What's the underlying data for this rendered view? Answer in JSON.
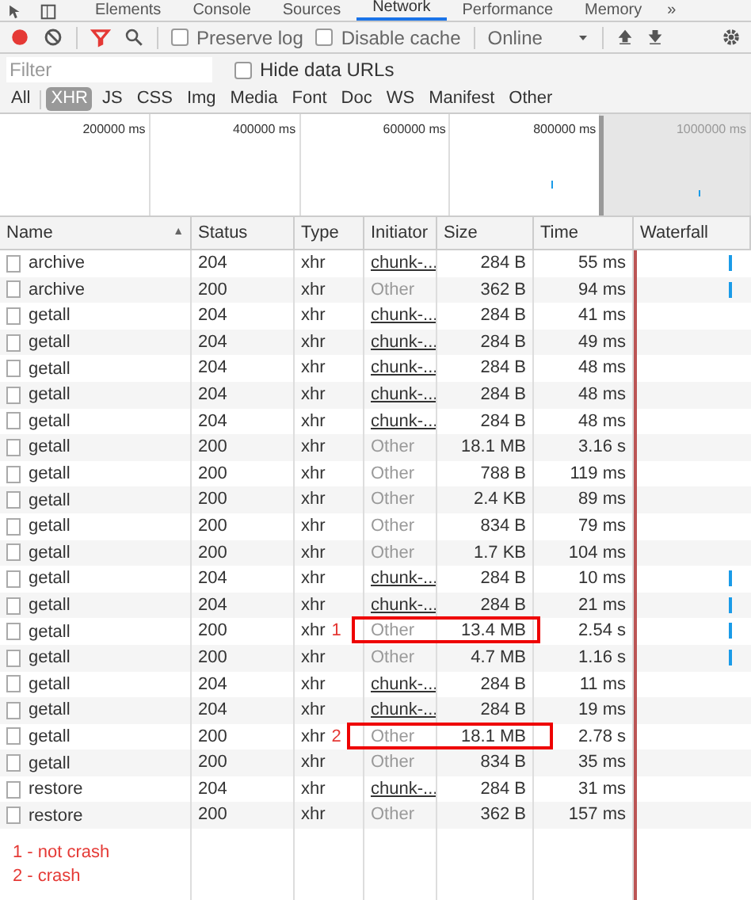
{
  "panel_tabs": [
    {
      "label": "Elements",
      "selected": false
    },
    {
      "label": "Console",
      "selected": false
    },
    {
      "label": "Sources",
      "selected": false
    },
    {
      "label": "Network",
      "selected": true
    },
    {
      "label": "Performance",
      "selected": false
    },
    {
      "label": "Memory",
      "selected": false
    }
  ],
  "more_tabs": "»",
  "toolbar": {
    "recording": true,
    "filter_active": true,
    "preserve_log": {
      "label": "Preserve log",
      "checked": false
    },
    "disable_cache": {
      "label": "Disable cache",
      "checked": false
    },
    "throttling": "Online"
  },
  "filter": {
    "placeholder": "Filter",
    "hide_data_urls": {
      "label": "Hide data URLs",
      "checked": false
    }
  },
  "type_filters": [
    {
      "label": "All",
      "selected": false
    },
    {
      "label": "XHR",
      "selected": true
    },
    {
      "label": "JS",
      "selected": false
    },
    {
      "label": "CSS",
      "selected": false
    },
    {
      "label": "Img",
      "selected": false
    },
    {
      "label": "Media",
      "selected": false
    },
    {
      "label": "Font",
      "selected": false
    },
    {
      "label": "Doc",
      "selected": false
    },
    {
      "label": "WS",
      "selected": false
    },
    {
      "label": "Manifest",
      "selected": false
    },
    {
      "label": "Other",
      "selected": false
    }
  ],
  "overview": {
    "ticks": [
      "200000 ms",
      "400000 ms",
      "600000 ms",
      "800000 ms",
      "1000000 ms"
    ]
  },
  "table": {
    "columns": [
      "Name",
      "Status",
      "Type",
      "Initiator",
      "Size",
      "Time",
      "Waterfall"
    ],
    "sort_indicator": "▲",
    "rows": [
      {
        "name": "archive",
        "status": "204",
        "type": "xhr",
        "initiator": "chunk-...",
        "initiator_link": true,
        "size": "284 B",
        "time": "55 ms",
        "waterfall_bar": true
      },
      {
        "name": "archive",
        "status": "200",
        "type": "xhr",
        "initiator": "Other",
        "initiator_link": false,
        "size": "362 B",
        "time": "94 ms",
        "waterfall_bar": true
      },
      {
        "name": "getall",
        "status": "204",
        "type": "xhr",
        "initiator": "chunk-...",
        "initiator_link": true,
        "size": "284 B",
        "time": "41 ms",
        "waterfall_bar": false
      },
      {
        "name": "getall",
        "status": "204",
        "type": "xhr",
        "initiator": "chunk-...",
        "initiator_link": true,
        "size": "284 B",
        "time": "49 ms",
        "waterfall_bar": false
      },
      {
        "name": "getall",
        "status": "204",
        "type": "xhr",
        "initiator": "chunk-...",
        "initiator_link": true,
        "size": "284 B",
        "time": "48 ms",
        "waterfall_bar": false
      },
      {
        "name": "getall",
        "status": "204",
        "type": "xhr",
        "initiator": "chunk-...",
        "initiator_link": true,
        "size": "284 B",
        "time": "48 ms",
        "waterfall_bar": false
      },
      {
        "name": "getall",
        "status": "204",
        "type": "xhr",
        "initiator": "chunk-...",
        "initiator_link": true,
        "size": "284 B",
        "time": "48 ms",
        "waterfall_bar": false
      },
      {
        "name": "getall",
        "status": "200",
        "type": "xhr",
        "initiator": "Other",
        "initiator_link": false,
        "size": "18.1 MB",
        "time": "3.16 s",
        "waterfall_bar": false
      },
      {
        "name": "getall",
        "status": "200",
        "type": "xhr",
        "initiator": "Other",
        "initiator_link": false,
        "size": "788 B",
        "time": "119 ms",
        "waterfall_bar": false
      },
      {
        "name": "getall",
        "status": "200",
        "type": "xhr",
        "initiator": "Other",
        "initiator_link": false,
        "size": "2.4 KB",
        "time": "89 ms",
        "waterfall_bar": false
      },
      {
        "name": "getall",
        "status": "200",
        "type": "xhr",
        "initiator": "Other",
        "initiator_link": false,
        "size": "834 B",
        "time": "79 ms",
        "waterfall_bar": false
      },
      {
        "name": "getall",
        "status": "200",
        "type": "xhr",
        "initiator": "Other",
        "initiator_link": false,
        "size": "1.7 KB",
        "time": "104 ms",
        "waterfall_bar": false
      },
      {
        "name": "getall",
        "status": "204",
        "type": "xhr",
        "initiator": "chunk-...",
        "initiator_link": true,
        "size": "284 B",
        "time": "10 ms",
        "waterfall_bar": true
      },
      {
        "name": "getall",
        "status": "204",
        "type": "xhr",
        "initiator": "chunk-...",
        "initiator_link": true,
        "size": "284 B",
        "time": "21 ms",
        "waterfall_bar": true
      },
      {
        "name": "getall",
        "status": "200",
        "type": "xhr",
        "initiator": "Other",
        "initiator_link": false,
        "size": "13.4 MB",
        "time": "2.54 s",
        "waterfall_bar": true,
        "annotation": "1",
        "highlighted": true
      },
      {
        "name": "getall",
        "status": "200",
        "type": "xhr",
        "initiator": "Other",
        "initiator_link": false,
        "size": "4.7 MB",
        "time": "1.16 s",
        "waterfall_bar": true
      },
      {
        "name": "getall",
        "status": "204",
        "type": "xhr",
        "initiator": "chunk-...",
        "initiator_link": true,
        "size": "284 B",
        "time": "11 ms",
        "waterfall_bar": false
      },
      {
        "name": "getall",
        "status": "204",
        "type": "xhr",
        "initiator": "chunk-...",
        "initiator_link": true,
        "size": "284 B",
        "time": "19 ms",
        "waterfall_bar": false
      },
      {
        "name": "getall",
        "status": "200",
        "type": "xhr",
        "initiator": "Other",
        "initiator_link": false,
        "size": "18.1 MB",
        "time": "2.78 s",
        "waterfall_bar": false,
        "annotation": "2",
        "highlighted": true
      },
      {
        "name": "getall",
        "status": "200",
        "type": "xhr",
        "initiator": "Other",
        "initiator_link": false,
        "size": "834 B",
        "time": "35 ms",
        "waterfall_bar": false
      },
      {
        "name": "restore",
        "status": "204",
        "type": "xhr",
        "initiator": "chunk-...",
        "initiator_link": true,
        "size": "284 B",
        "time": "31 ms",
        "waterfall_bar": false
      },
      {
        "name": "restore",
        "status": "200",
        "type": "xhr",
        "initiator": "Other",
        "initiator_link": false,
        "size": "362 B",
        "time": "157 ms",
        "waterfall_bar": false
      }
    ]
  },
  "notes": [
    "1 - not crash",
    "2 - crash"
  ]
}
